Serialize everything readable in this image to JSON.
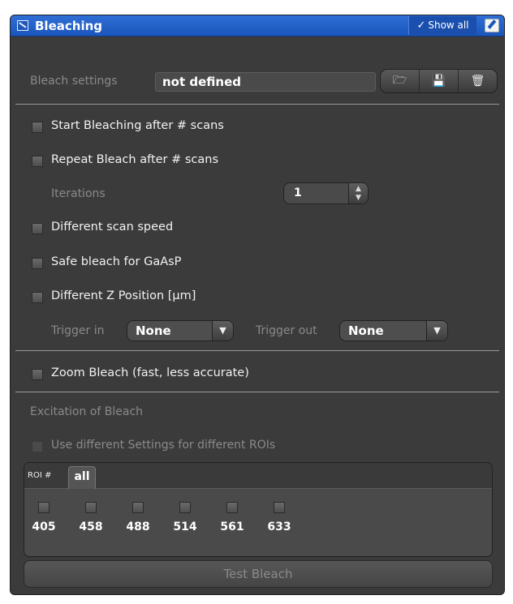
{
  "window": {
    "title": "Bleaching",
    "show_all_label": "Show all",
    "icons": {
      "panel": "collapse-panel-icon",
      "edit": "edit-icon",
      "check": "checkmark-icon"
    }
  },
  "bleach_settings": {
    "label": "Bleach settings",
    "value": "not defined",
    "buttons": [
      {
        "name": "open-folder-icon",
        "glyph": "🗁"
      },
      {
        "name": "save-disk-icon",
        "glyph": "💾"
      },
      {
        "name": "trash-icon",
        "glyph": "🗑"
      }
    ]
  },
  "options": {
    "start_bleaching": "Start Bleaching after # scans",
    "repeat_bleach": "Repeat Bleach after # scans",
    "iterations_label": "Iterations",
    "iterations_value": "1",
    "different_scan_speed": "Different scan speed",
    "safe_bleach": "Safe bleach for GaAsP",
    "different_z": "Different Z Position [µm]",
    "trigger_in_label": "Trigger in",
    "trigger_in_value": "None",
    "trigger_out_label": "Trigger out",
    "trigger_out_value": "None",
    "zoom_bleach": "Zoom Bleach (fast, less accurate)"
  },
  "excitation": {
    "heading": "Excitation of Bleach",
    "different_settings": "Use different Settings for different ROIs",
    "roi_label": "ROI #",
    "roi_tab": "all",
    "lasers": [
      "405",
      "458",
      "488",
      "514",
      "561",
      "633"
    ]
  },
  "test_bleach_label": "Test Bleach",
  "colors": {
    "title_bar": "#1f5fc8",
    "panel_bg": "#3b3b3b",
    "text": "#f2f2f2",
    "disabled_text": "#8a8a8a"
  }
}
